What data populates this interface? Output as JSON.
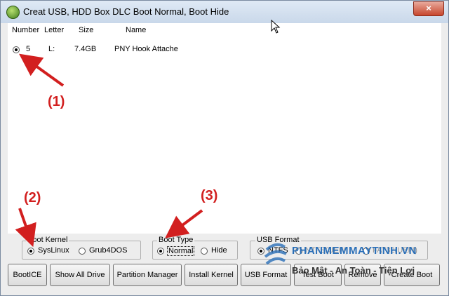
{
  "window": {
    "title": "Creat USB, HDD Box DLC Boot Normal, Boot Hide",
    "close_glyph": "×"
  },
  "list": {
    "columns": [
      "Number",
      "Letter",
      "Size",
      "Name"
    ],
    "rows": [
      {
        "number": "5",
        "letter": "L:",
        "size": "7.4GB",
        "name": "PNY Hook Attache",
        "selected": true
      }
    ]
  },
  "boot_kernel": {
    "label": "Boot Kernel",
    "options": [
      "SysLinux",
      "Grub4DOS"
    ],
    "selected": "SysLinux"
  },
  "boot_type": {
    "label": "Boot Type",
    "options": [
      "Normal",
      "Hide"
    ],
    "selected": "Normal"
  },
  "usb_format": {
    "label": "USB Format",
    "options": [
      "NTFS",
      "NTFS(UEFI)",
      "FAT32(UEFI)"
    ]
  },
  "buttons": [
    "BootICE",
    "Show All Drive",
    "Partition Manager",
    "Install Kernel",
    "USB Format",
    "Test Boot",
    "Remove",
    "Create Boot"
  ],
  "annotations": [
    "(1)",
    "(2)",
    "(3)"
  ],
  "watermark": {
    "site": "PHANMEMMAYTINH.VN",
    "tagline": "Bảo Mật - An Toàn - Tiện Lợi"
  },
  "colors": {
    "annotation": "#d21f1f",
    "watermark": "#2a6fb8",
    "titlebar": "#c9d8ea",
    "close": "#c7462d"
  },
  "icons": [
    "app-icon",
    "close-icon",
    "mouse-cursor-icon",
    "watermark-logo-icon"
  ]
}
